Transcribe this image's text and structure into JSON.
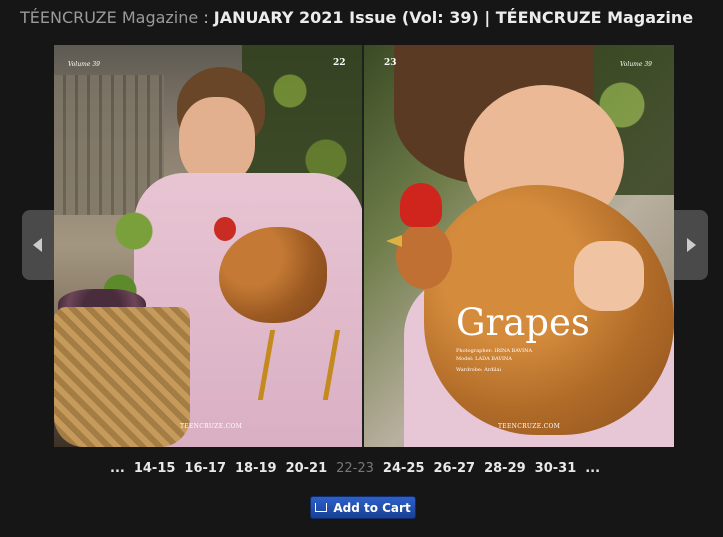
{
  "header": {
    "brand": "TÉENCRUZE Magazine",
    "separator": " : ",
    "issue": "JANUARY 2021 Issue (Vol: 39) | TÉENCRUZE Magazine"
  },
  "viewer": {
    "left_page": {
      "volume_label": "Volume 39",
      "page_number": "22",
      "footer_brand": "TEENCRUZE.COM"
    },
    "right_page": {
      "volume_label": "Volume 39",
      "page_number": "23",
      "feature_title": "Grapes",
      "credits_line1": "Photographer: IRINA BAVINA",
      "credits_line2": "Model: LADA BAVINA",
      "credits_line3": "Wardrobe: Ardilai",
      "footer_brand": "TEENCRUZE.COM"
    },
    "prev_icon": "chevron-left-icon",
    "next_icon": "chevron-right-icon"
  },
  "pager": {
    "leading_ellipsis": "...",
    "pages": [
      "14-15",
      "16-17",
      "18-19",
      "20-21",
      "22-23",
      "24-25",
      "26-27",
      "28-29",
      "30-31"
    ],
    "current": "22-23",
    "trailing_ellipsis": "..."
  },
  "cart": {
    "label": "Add to Cart",
    "icon": "cart-icon",
    "color": "#1f4fae"
  },
  "colors": {
    "background": "#161616",
    "brand_text": "#9a9a9a",
    "issue_text": "#ececec"
  }
}
